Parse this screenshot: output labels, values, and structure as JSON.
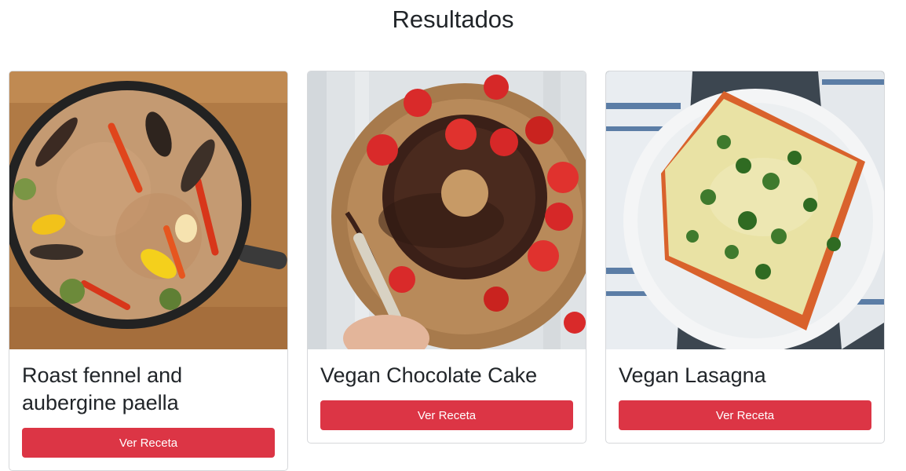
{
  "page": {
    "title": "Resultados"
  },
  "recipes": [
    {
      "title": "Roast fennel and aubergine paella",
      "button_label": "Ver Receta",
      "image": "paella-photo"
    },
    {
      "title": "Vegan Chocolate Cake",
      "button_label": "Ver Receta",
      "image": "chocolate-cake-photo"
    },
    {
      "title": "Vegan Lasagna",
      "button_label": "Ver Receta",
      "image": "lasagna-photo"
    }
  ],
  "colors": {
    "button_bg": "#dc3545",
    "button_text": "#ffffff",
    "card_border": "#d6d8db"
  }
}
